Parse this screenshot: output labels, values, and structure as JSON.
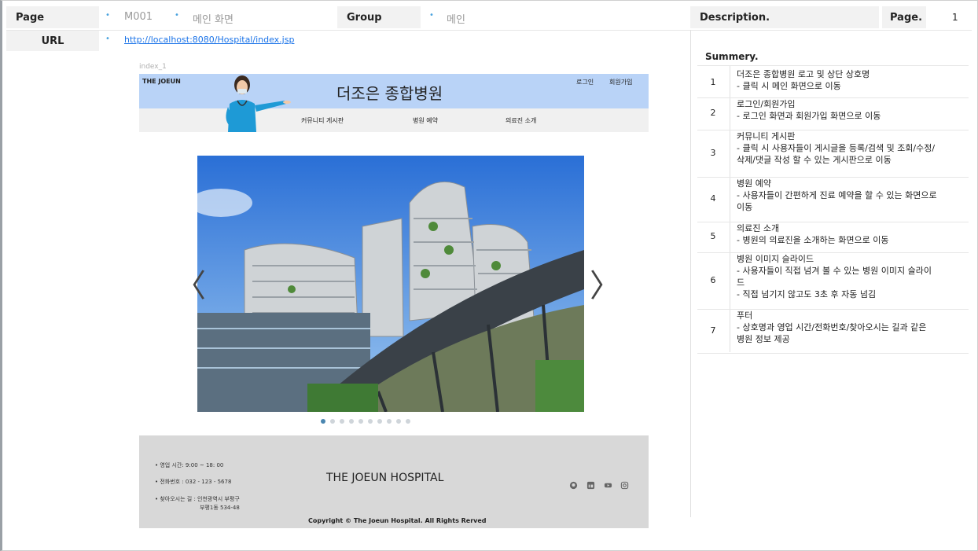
{
  "meta": {
    "page_label": "Page",
    "page_id": "M001",
    "page_name": "메인 화면",
    "group_label": "Group",
    "group_name": "메인",
    "description_label": "Description.",
    "page_num_label": "Page.",
    "page_num": "1",
    "url_label": "URL",
    "url": "http://localhost:8080/Hospital/index.jsp"
  },
  "screen": {
    "caption": "index_1",
    "brand": "THE JOEUN",
    "site_name": "더조은 종합병원",
    "login": "로그인",
    "signup": "회원가입",
    "nav": [
      "커뮤니티 게시판",
      "병원 예약",
      "의료진 소개"
    ],
    "prev_arrow": "〈",
    "next_arrow": "〉",
    "slide_count": 10,
    "active_slide": 0,
    "footer": {
      "hours": "• 영업 시간: 9:00 ~ 18: 00",
      "phone": "• 전화번호 : 032 - 123 - 5678",
      "address_1": "• 찾아오시는 길 : 인천광역시 부평구",
      "address_2": "부평1동 534-48",
      "title": "THE JOEUN HOSPITAL",
      "copyright": "Copyright © The Joeun Hospital. All Rights Rerved",
      "social_icons": [
        "github-icon",
        "linkedin-icon",
        "youtube-icon",
        "instagram-icon"
      ]
    }
  },
  "summary": {
    "title": "Summery.",
    "rows": [
      {
        "num": "1",
        "lines": [
          "더조은 종합병원 로고 및 상단 상호명",
          "- 클릭 시 메인 화면으로 이동"
        ]
      },
      {
        "num": "2",
        "lines": [
          "로그인/회원가입",
          "- 로그인 화면과 회원가입 화면으로 이동"
        ]
      },
      {
        "num": "3",
        "lines": [
          "커뮤니티 게시판",
          "-   클릭 시 사용자들이 게시글을 등록/검색 및 조회/수정/",
          "    삭제/댓글 작성 할 수 있는 게시판으로 이동"
        ]
      },
      {
        "num": "4",
        "lines": [
          "병원 예약",
          "- 사용자들이 간편하게 진료 예약을 할 수 있는 화면으로",
          "이동"
        ]
      },
      {
        "num": "5",
        "lines": [
          "의료진 소개",
          "-   병원의 의료진을 소개하는 화면으로 이동"
        ]
      },
      {
        "num": "6",
        "lines": [
          "병원 이미지 슬라이드",
          "-   사용자들이 직접 넘겨 볼 수 있는 병원 이미지 슬라이",
          "    드",
          "-   직접 넘기지 않고도 3초 후 자동 넘김"
        ]
      },
      {
        "num": "7",
        "lines": [
          "푸터",
          "-   상호명과 영업 시간/전화번호/찾아오시는 길과 같은",
          "    병원 정보 제공"
        ]
      }
    ]
  }
}
